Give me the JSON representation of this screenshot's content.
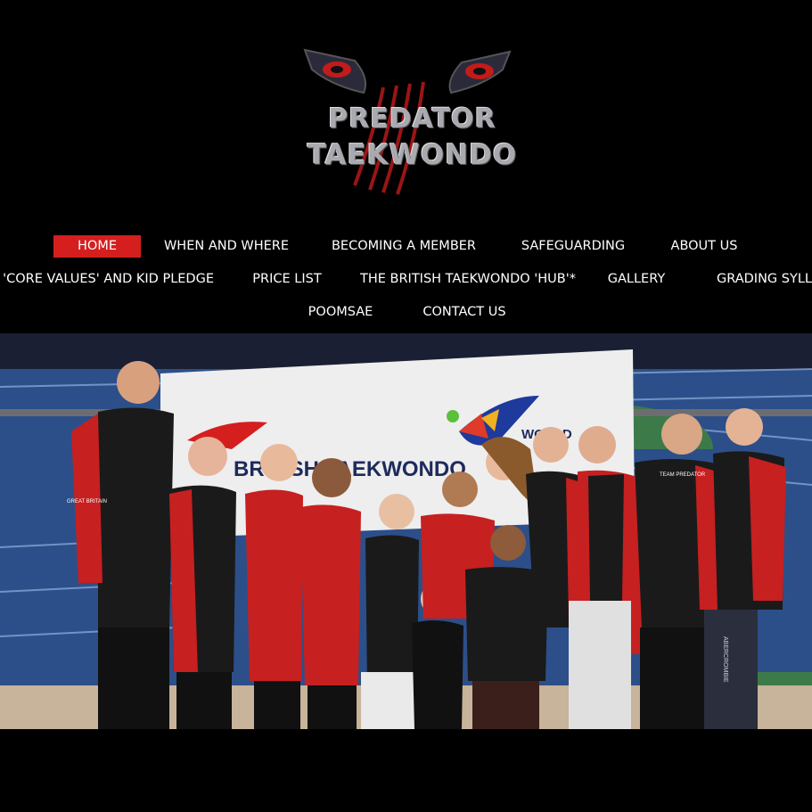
{
  "logo": {
    "line1": "PREDATOR",
    "line2": "TAEKWONDO"
  },
  "nav": {
    "row1": [
      "HOME",
      "WHEN AND WHERE",
      "BECOMING A MEMBER",
      "SAFEGUARDING",
      "ABOUT US"
    ],
    "row2": [
      "CLUB 'CORE VALUES' AND KID PLEDGE",
      "PRICE LIST",
      "THE BRITISH TAEKWONDO 'HUB'*",
      "GALLERY",
      "GRADING SYLLABUS"
    ],
    "row3": [
      "POOMSAE",
      "CONTACT US"
    ],
    "active": "HOME"
  },
  "hero": {
    "banner_left": "BRITISH TAEKWONDO",
    "banner_right": "WORLD",
    "shirt_text_1": "GREAT BRITAIN",
    "shirt_text_2": "TEAM PREDATOR",
    "pants_text": "ABERCROMBIE"
  },
  "colors": {
    "background": "#000000",
    "accent": "#d51f1f",
    "nav_text": "#ffffff",
    "logo_grey": "#a9a9b0"
  }
}
